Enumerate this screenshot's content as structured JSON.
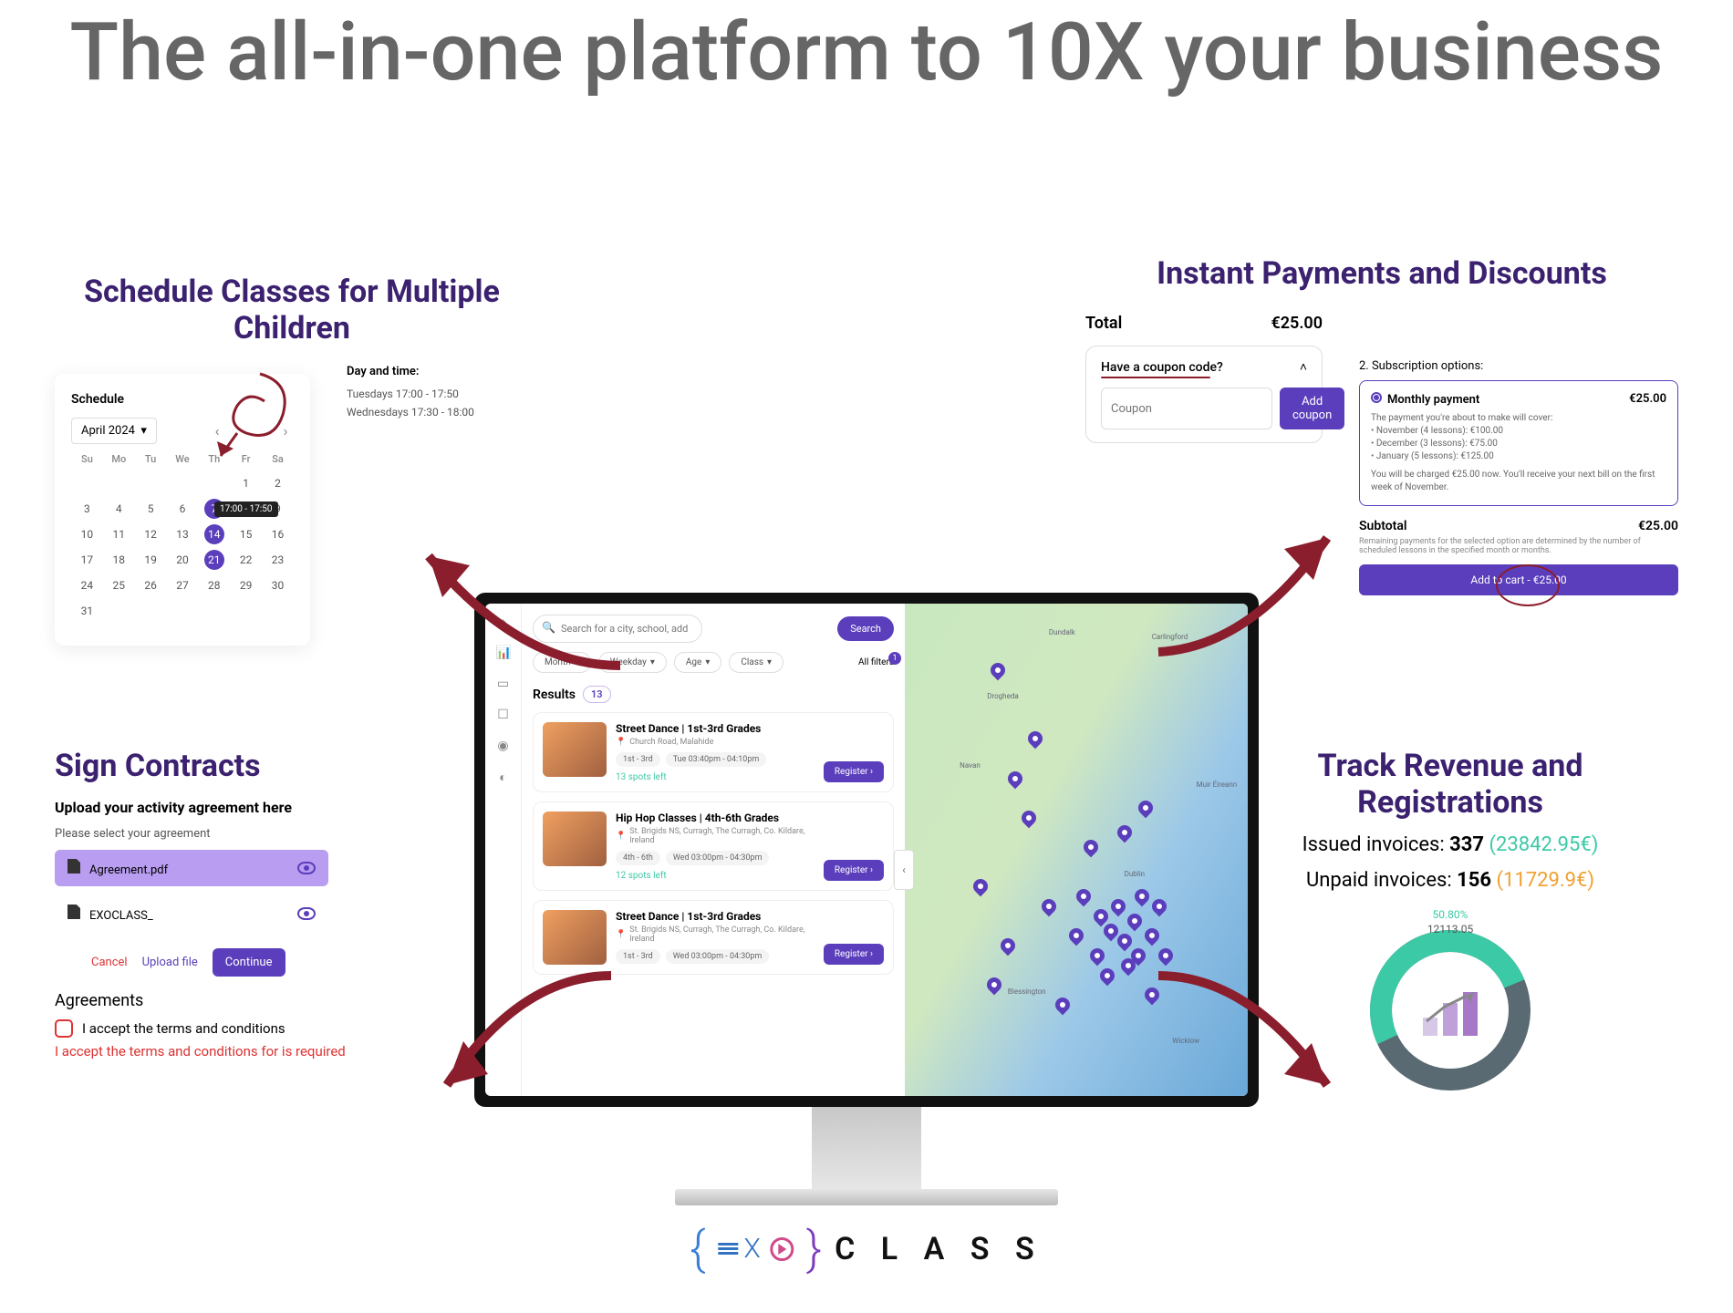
{
  "hero": "The all-in-one platform to 10X your business",
  "sections": {
    "schedule": "Schedule Classes for Multiple Children",
    "payments": "Instant Payments and Discounts",
    "contracts": "Sign Contracts",
    "revenue": "Track Revenue and Registrations"
  },
  "schedule": {
    "label": "Schedule",
    "month": "April 2024",
    "dow": [
      "Su",
      "Mo",
      "Tu",
      "We",
      "Th",
      "Fr",
      "Sa"
    ],
    "weeks": [
      [
        "",
        "1",
        "2",
        "3",
        "4",
        "5",
        "6"
      ],
      [
        "7",
        "8",
        "9",
        "10",
        "11",
        "12",
        "13"
      ],
      [
        "14",
        "15",
        "16",
        "17",
        "18",
        "19",
        "20"
      ],
      [
        "21",
        "22",
        "23",
        "24",
        "25",
        "26",
        "27"
      ],
      [
        "28",
        "29",
        "30",
        "31",
        "",
        "",
        ""
      ]
    ],
    "weeks_display": [
      [
        "",
        "",
        "",
        "",
        "",
        "1",
        "2"
      ],
      [
        "3",
        "4",
        "5",
        "6",
        "7",
        "8",
        "9"
      ],
      [
        "10",
        "11",
        "12",
        "13",
        "14",
        "15",
        "16"
      ],
      [
        "17",
        "18",
        "19",
        "20",
        "21",
        "22",
        "23"
      ],
      [
        "24",
        "25",
        "26",
        "27",
        "28",
        "29",
        "30"
      ],
      [
        "31",
        "",
        "",
        "",
        "",
        "",
        ""
      ]
    ],
    "selected": [
      "7",
      "14",
      "21"
    ],
    "tooltip": "17:00 - 17:50",
    "dt_header": "Day and time:",
    "dt_rows": [
      "Tuesdays 17:00 - 17:50",
      "Wednesdays 17:30 - 18:00"
    ]
  },
  "payments": {
    "total_label": "Total",
    "total_value": "€25.00",
    "coupon_q": "Have a coupon code?",
    "coupon_ph": "Coupon",
    "coupon_btn": "Add coupon",
    "sub_title": "2. Subscription options:",
    "option_name": "Monthly payment",
    "option_price": "€25.00",
    "option_desc": "The payment you're about to make will cover:",
    "option_lines": [
      "• November (4 lessons): €100.00",
      "• December (3 lessons): €75.00",
      "• January (5 lessons): €125.00"
    ],
    "option_foot": "You will be charged €25.00 now. You'll receive your next bill on the first week of November.",
    "subtotal_label": "Subtotal",
    "subtotal_value": "€25.00",
    "sub_note": "Remaining payments for the selected option are determined by the number of scheduled lessons in the specified month or months.",
    "atc": "Add to cart - €25.00"
  },
  "contracts": {
    "h1": "Upload your activity agreement here",
    "h2": "Please select your agreement",
    "files": [
      "Agreement.pdf",
      "EXOCLASS_"
    ],
    "cancel": "Cancel",
    "upload": "Upload file",
    "cont": "Continue",
    "agreements": "Agreements",
    "accept": "I accept the terms and conditions",
    "err": "I accept the terms and conditions for is required"
  },
  "revenue": {
    "issued_l": "Issued invoices: ",
    "issued_n": "337",
    "issued_v": "(23842.95€)",
    "unpaid_l": "Unpaid invoices: ",
    "unpaid_n": "156",
    "unpaid_v": "(11729.9€)",
    "pct": "50.80%",
    "val": "12113.05"
  },
  "app": {
    "search_ph": "Search for a city, school, address or activity",
    "search_btn": "Search",
    "filters": [
      "Month",
      "Weekday",
      "Age",
      "Class"
    ],
    "all_filters": "All filters",
    "results": "Results",
    "count": "13",
    "items": [
      {
        "title": "Street Dance | 1st-3rd Grades",
        "loc": "Church Road, Malahide",
        "tags": [
          "1st - 3rd",
          "Tue 03:40pm - 04:10pm"
        ],
        "spots": "13 spots left",
        "spots_cls": ""
      },
      {
        "title": "Hip Hop Classes  | 4th-6th Grades",
        "loc": "St. Brigids NS, Curragh, The Curragh, Co. Kildare, Ireland",
        "tags": [
          "4th - 6th",
          "Wed 03:00pm - 04:30pm"
        ],
        "spots": "12 spots left",
        "spots_cls": ""
      },
      {
        "title": "Street Dance | 1st-3rd Grades",
        "loc": "St. Brigids NS, Curragh, The Curragh, Co. Kildare, Ireland",
        "tags": [
          "1st - 3rd",
          "Wed 03:00pm - 04:30pm"
        ],
        "spots": "",
        "spots_cls": ""
      }
    ],
    "register": "Register",
    "map_labels": [
      "Drogheda",
      "Dundalk",
      "Carlingford",
      "Navan",
      "Dublin",
      "Blessington",
      "Wicklow",
      "Muir Éireann"
    ]
  },
  "logo": {
    "class": "C L A S S"
  }
}
